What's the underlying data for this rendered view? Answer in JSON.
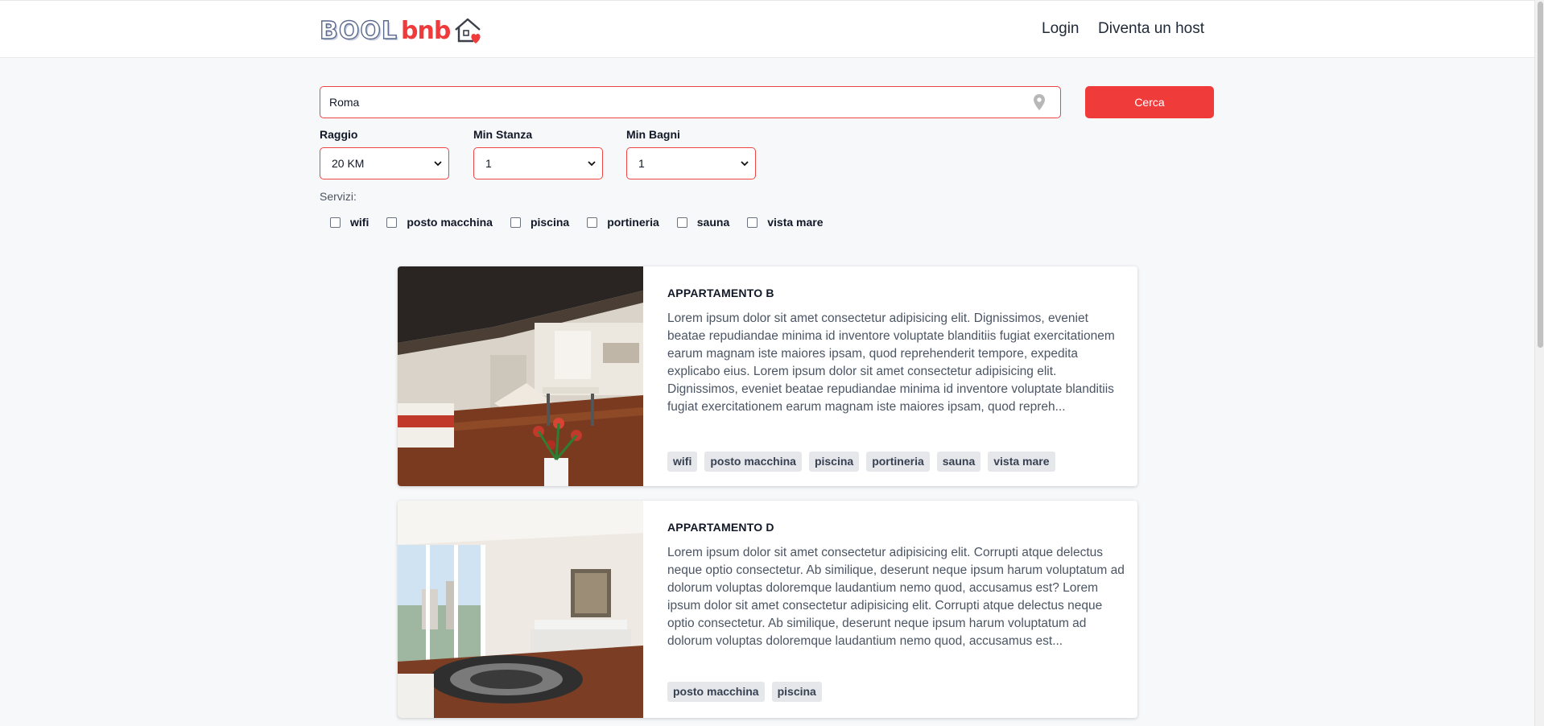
{
  "brand": {
    "logo_part1": "BOOL",
    "logo_part2": "bnb"
  },
  "nav": {
    "login": "Login",
    "host": "Diventa un host"
  },
  "search": {
    "value": "Roma",
    "button": "Cerca"
  },
  "filters": {
    "raggio": {
      "label": "Raggio",
      "value": "20 KM"
    },
    "stanze": {
      "label": "Min Stanza",
      "value": "1"
    },
    "bagni": {
      "label": "Min Bagni",
      "value": "1"
    }
  },
  "servizi": {
    "label": "Servizi:",
    "options": [
      "wifi",
      "posto macchina",
      "piscina",
      "portineria",
      "sauna",
      "vista mare"
    ]
  },
  "listings": [
    {
      "title": "APPARTAMENTO B",
      "description": "Lorem ipsum dolor sit amet consectetur adipisicing elit. Dignissimos, eveniet beatae repudiandae minima id inventore voluptate blanditiis fugiat exercitationem earum magnam iste maiores ipsam, quod reprehenderit tempore, expedita explicabo eius. Lorem ipsum dolor sit amet consectetur adipisicing elit. Dignissimos, eveniet beatae repudiandae minima id inventore voluptate blanditiis fugiat exercitationem earum magnam iste maiores ipsam, quod repreh...",
      "tags": [
        "wifi",
        "posto macchina",
        "piscina",
        "portineria",
        "sauna",
        "vista mare"
      ]
    },
    {
      "title": "APPARTAMENTO D",
      "description": "Lorem ipsum dolor sit amet consectetur adipisicing elit. Corrupti atque delectus neque optio consectetur. Ab similique, deserunt neque ipsum harum voluptatum ad dolorum voluptas doloremque laudantium nemo quod, accusamus est? Lorem ipsum dolor sit amet consectetur adipisicing elit. Corrupti atque delectus neque optio consectetur. Ab similique, deserunt neque ipsum harum voluptatum ad dolorum voluptas doloremque laudantium nemo quod, accusamus est...",
      "tags": [
        "posto macchina",
        "piscina"
      ]
    }
  ],
  "icons": {
    "logo": "house-heart-icon",
    "location": "map-pin-icon",
    "dropdown": "chevron-down-icon"
  },
  "colors": {
    "accent": "#f03b3b",
    "tag_bg": "#e5e7eb",
    "page_bg": "#f7f8fa"
  }
}
